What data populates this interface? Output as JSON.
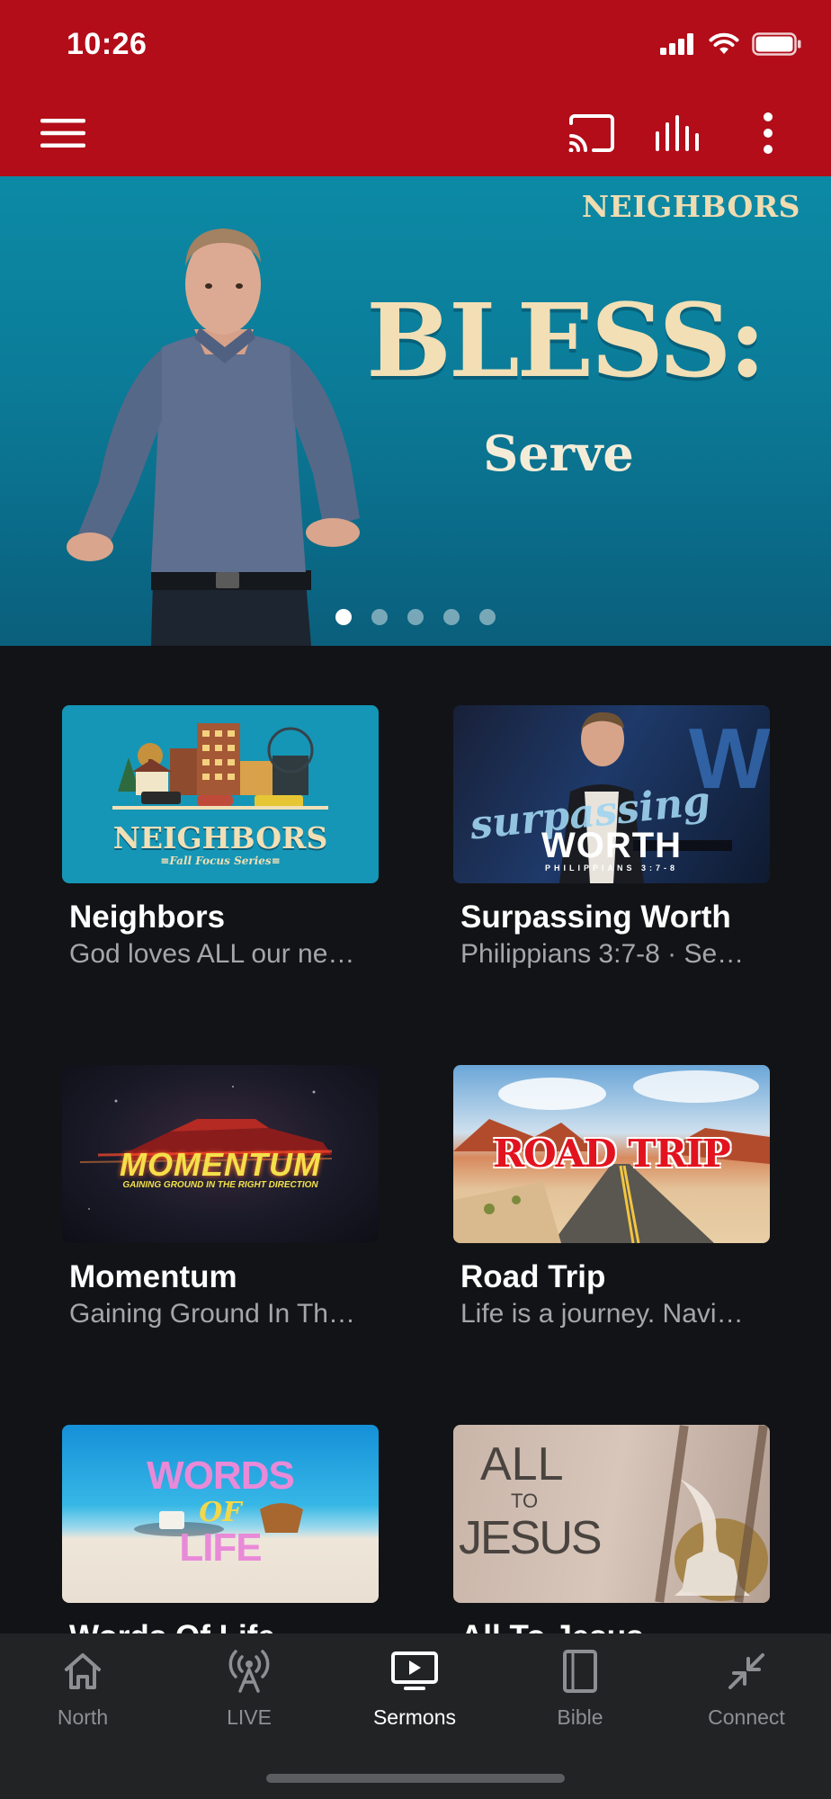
{
  "status_bar": {
    "time": "10:26",
    "battery_level": 1.0
  },
  "app_bar": {
    "menu_icon": "hamburger-icon",
    "actions": [
      "cast-icon",
      "audio-bars-icon",
      "more-vertical-icon"
    ]
  },
  "hero": {
    "series_logo": "NEIGHBORS",
    "title": "BLESS:",
    "subtitle": "Serve",
    "page_count": 5,
    "active_page": 1
  },
  "series": [
    {
      "title": "Neighbors",
      "subtitle": "God loves ALL our ne…",
      "thumb": {
        "logo": "NEIGHBORS",
        "caption": "≡Fall Focus Series≡"
      }
    },
    {
      "title": "Surpassing Worth",
      "subtitle": "Philippians 3:7-8 · Se…",
      "thumb": {
        "script": "surpassing",
        "word": "WORTH",
        "ref": "PHILIPPIANS 3:7-8"
      }
    },
    {
      "title": "Momentum",
      "subtitle": "Gaining Ground In Th…",
      "thumb": {
        "word": "MOMENTUM",
        "tagline": "GAINING GROUND IN THE RIGHT DIRECTION"
      }
    },
    {
      "title": "Road Trip",
      "subtitle": "Life is a journey. Navi…",
      "thumb": {
        "word": "ROAD TRIP"
      }
    },
    {
      "title": "Words Of Life",
      "subtitle": "",
      "thumb": {
        "line1": "WORDS",
        "line2": "OF",
        "line3": "LIFE"
      }
    },
    {
      "title": "All To Jesus",
      "subtitle": "",
      "thumb": {
        "line1": "ALL",
        "line2": "TO",
        "line3": "JESUS"
      }
    }
  ],
  "tabs": [
    {
      "label": "North",
      "icon": "home-icon",
      "active": false
    },
    {
      "label": "LIVE",
      "icon": "broadcast-antenna-icon",
      "active": false
    },
    {
      "label": "Sermons",
      "icon": "video-screen-icon",
      "active": true
    },
    {
      "label": "Bible",
      "icon": "book-icon",
      "active": false
    },
    {
      "label": "Connect",
      "icon": "arrows-inward-icon",
      "active": false
    }
  ],
  "colors": {
    "brand_red": "#b20d19",
    "background": "#121316",
    "tab_bar": "#222325",
    "muted_text": "#a5a6aa",
    "hero_teal": "#0b7b98"
  }
}
